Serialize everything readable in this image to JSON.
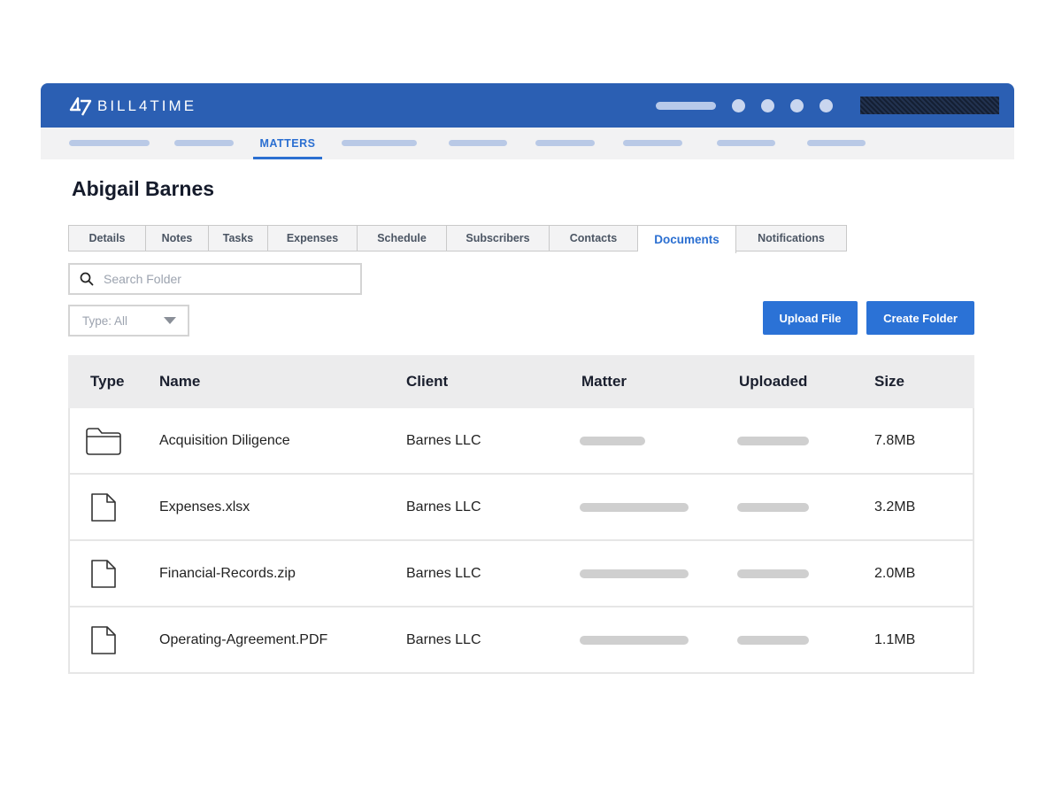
{
  "app": {
    "brand": "BILL4TIME"
  },
  "nav": {
    "active_label": "MATTERS"
  },
  "page": {
    "title": "Abigail Barnes"
  },
  "tabs": [
    {
      "label": "Details"
    },
    {
      "label": "Notes"
    },
    {
      "label": "Tasks"
    },
    {
      "label": "Expenses"
    },
    {
      "label": "Schedule"
    },
    {
      "label": "Subscribers"
    },
    {
      "label": "Contacts"
    },
    {
      "label": "Documents",
      "active": true
    },
    {
      "label": "Notifications"
    }
  ],
  "search": {
    "placeholder": "Search Folder"
  },
  "type_filter": {
    "value": "Type: All"
  },
  "buttons": {
    "upload": "Upload File",
    "create_folder": "Create Folder"
  },
  "table": {
    "headers": {
      "type": "Type",
      "name": "Name",
      "client": "Client",
      "matter": "Matter",
      "uploaded": "Uploaded",
      "size": "Size"
    },
    "rows": [
      {
        "type_icon": "folder-icon",
        "name": "Acquisition Diligence",
        "client": "Barnes LLC",
        "size": "7.8MB"
      },
      {
        "type_icon": "file-icon",
        "name": "Expenses.xlsx",
        "client": "Barnes LLC",
        "size": "3.2MB"
      },
      {
        "type_icon": "file-icon",
        "name": "Financial-Records.zip",
        "client": "Barnes LLC",
        "size": "2.0MB"
      },
      {
        "type_icon": "file-icon",
        "name": "Operating-Agreement.PDF",
        "client": "Barnes LLC",
        "size": "1.1MB"
      }
    ]
  },
  "colors": {
    "brand_blue": "#2b5fb3",
    "accent_blue": "#2b72d6"
  }
}
